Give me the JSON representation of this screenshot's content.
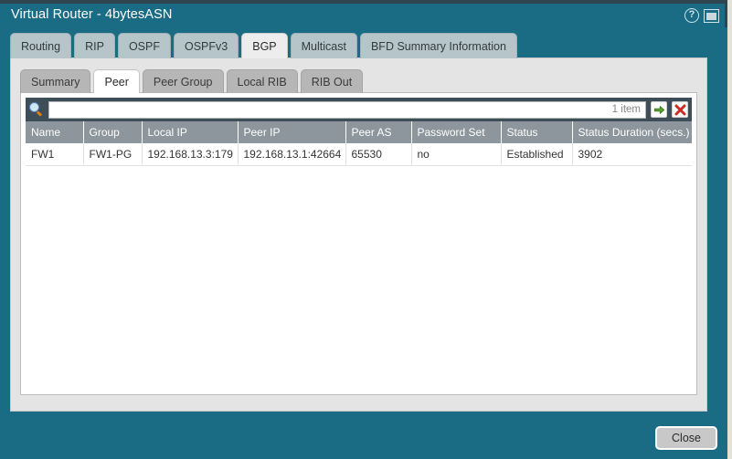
{
  "window": {
    "title": "Virtual Router - 4bytesASN",
    "help_icon": "question-circle-icon",
    "restore_icon": "window-restore-icon"
  },
  "main_tabs": [
    {
      "label": "Routing",
      "active": false
    },
    {
      "label": "RIP",
      "active": false
    },
    {
      "label": "OSPF",
      "active": false
    },
    {
      "label": "OSPFv3",
      "active": false
    },
    {
      "label": "BGP",
      "active": true
    },
    {
      "label": "Multicast",
      "active": false
    },
    {
      "label": "BFD Summary Information",
      "active": false
    }
  ],
  "sub_tabs": [
    {
      "label": "Summary",
      "active": false
    },
    {
      "label": "Peer",
      "active": true
    },
    {
      "label": "Peer Group",
      "active": false
    },
    {
      "label": "Local RIB",
      "active": false
    },
    {
      "label": "RIB Out",
      "active": false
    }
  ],
  "toolbar": {
    "search_icon": "search-icon",
    "search_value": "",
    "search_placeholder": "",
    "item_count": "1 item",
    "go_icon": "arrow-right-icon",
    "clear_icon": "red-x-icon"
  },
  "table": {
    "columns": [
      "Name",
      "Group",
      "Local IP",
      "Peer IP",
      "Peer AS",
      "Password Set",
      "Status",
      "Status Duration (secs.)"
    ],
    "rows": [
      {
        "name": "FW1",
        "group": "FW1-PG",
        "local_ip": "192.168.13.3:179",
        "peer_ip": "192.168.13.1:42664",
        "peer_as": "65530",
        "password_set": "no",
        "status": "Established",
        "status_duration": "3902"
      }
    ]
  },
  "footer": {
    "close_label": "Close"
  },
  "colors": {
    "window_bg": "#1a6c85",
    "panel_bg": "#e4e4e4",
    "toolbar_bg": "#3e4e58",
    "header_bg": "#8c969c",
    "link": "#2288ad",
    "go_green": "#4b9b2e",
    "clear_red": "#cc2b22"
  }
}
